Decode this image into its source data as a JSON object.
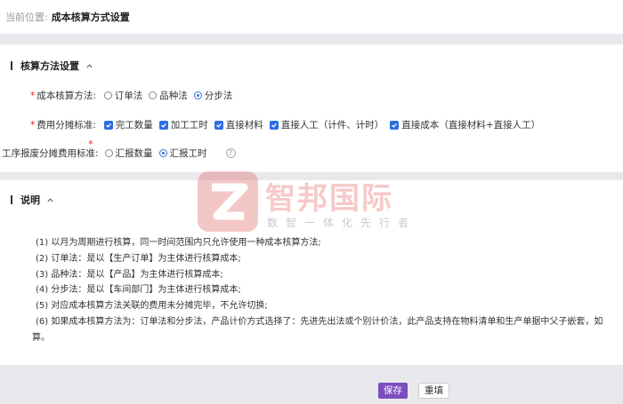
{
  "breadcrumb": {
    "label": "当前位置:",
    "current": "成本核算方式设置"
  },
  "section1": {
    "title": "核算方法设置",
    "method": {
      "label": "成本核算方法:",
      "options": [
        "订单法",
        "品种法",
        "分步法"
      ],
      "selected": "分步法"
    },
    "allocation": {
      "label": "费用分摊标准:",
      "options": [
        "完工数量",
        "加工工时",
        "直接材料",
        "直接人工（计件、计时）",
        "直接成本（直接材料+直接人工）"
      ],
      "checked": [
        true,
        true,
        true,
        true,
        true
      ]
    },
    "process": {
      "label": "工序报废分摊费用标准:",
      "options": [
        "汇报数量",
        "汇报工时"
      ],
      "selected": "汇报工时"
    }
  },
  "section2": {
    "title": "说明",
    "lines": [
      "(1) 以月为周期进行核算，同一时间范围内只允许使用一种成本核算方法;",
      "(2) 订单法：是以【生产订单】为主体进行核算成本;",
      "(3) 品种法：是以【产品】为主体进行核算成本;",
      "(4) 分步法：是以【车间部门】为主体进行核算成本;",
      "(5) 对应成本核算方法关联的费用未分摊完毕，不允许切换;",
      "(6) 如果成本核算方法为：订单法和分步法，产品计价方式选择了：先进先出法或个别计价法，此产品支持在物料清单和生产单据中父子嵌套，如",
      "算。"
    ]
  },
  "footer": {
    "save": "保存",
    "reset": "重填"
  },
  "watermark": {
    "name": "智邦国际",
    "slogan": "数智一体化先行者"
  },
  "colors": {
    "accent": "#7b4dbf",
    "checkbox": "#2d6fe0",
    "required": "#e02020",
    "watermark": "#e88888"
  }
}
